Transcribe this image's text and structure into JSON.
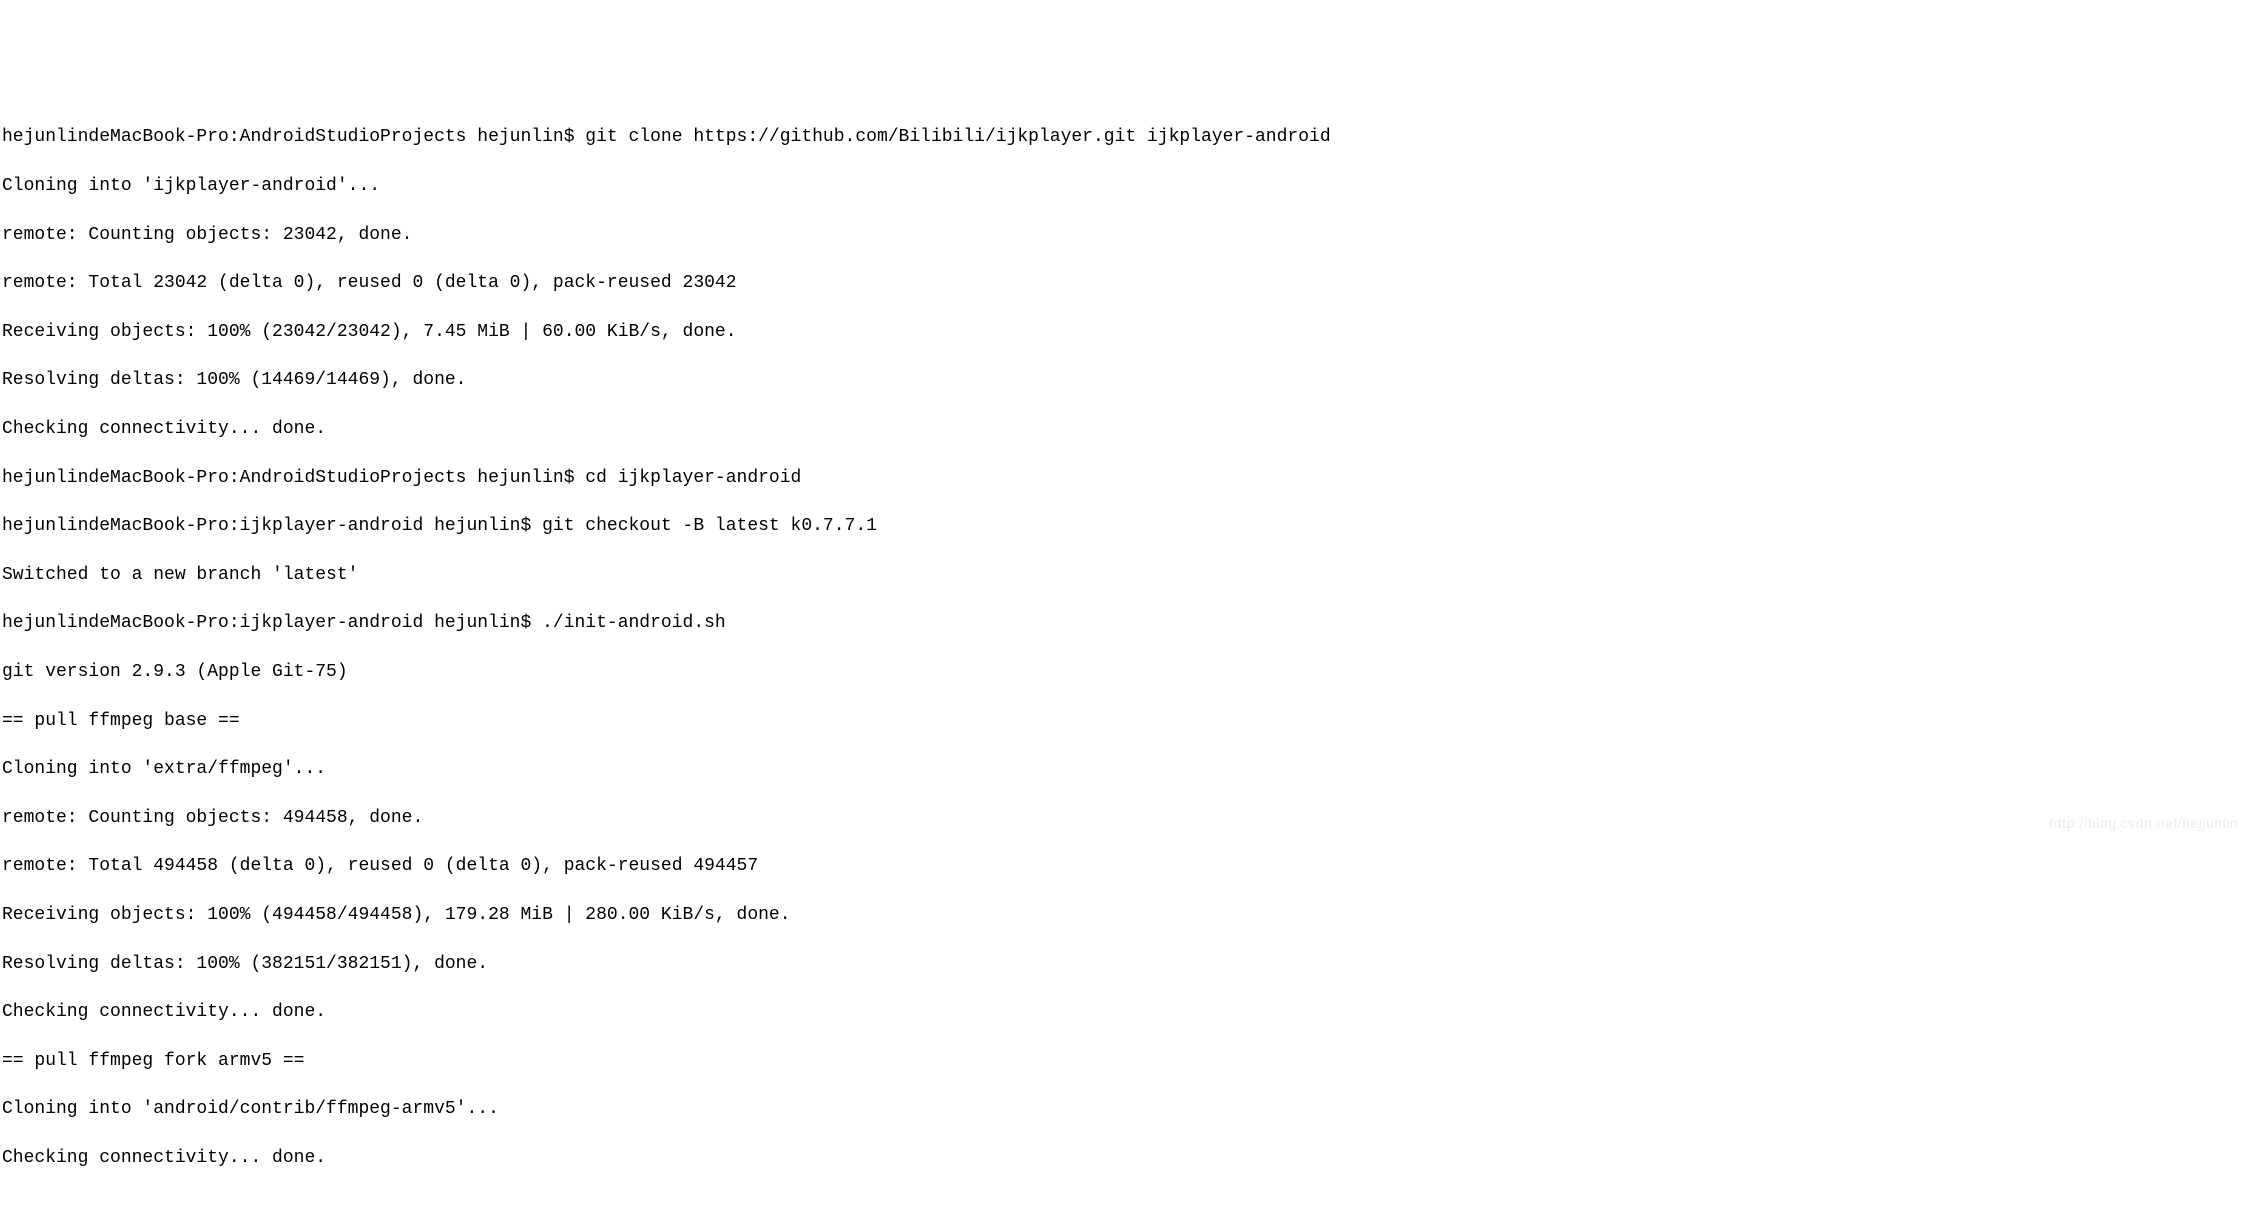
{
  "terminal": {
    "lines": [
      "hejunlindeMacBook-Pro:AndroidStudioProjects hejunlin$ git clone https://github.com/Bilibili/ijkplayer.git ijkplayer-android",
      "Cloning into 'ijkplayer-android'...",
      "remote: Counting objects: 23042, done.",
      "remote: Total 23042 (delta 0), reused 0 (delta 0), pack-reused 23042",
      "Receiving objects: 100% (23042/23042), 7.45 MiB | 60.00 KiB/s, done.",
      "Resolving deltas: 100% (14469/14469), done.",
      "Checking connectivity... done.",
      "hejunlindeMacBook-Pro:AndroidStudioProjects hejunlin$ cd ijkplayer-android",
      "hejunlindeMacBook-Pro:ijkplayer-android hejunlin$ git checkout -B latest k0.7.7.1",
      "Switched to a new branch 'latest'",
      "hejunlindeMacBook-Pro:ijkplayer-android hejunlin$ ./init-android.sh",
      "git version 2.9.3 (Apple Git-75)",
      "== pull ffmpeg base ==",
      "Cloning into 'extra/ffmpeg'...",
      "remote: Counting objects: 494458, done.",
      "remote: Total 494458 (delta 0), reused 0 (delta 0), pack-reused 494457",
      "Receiving objects: 100% (494458/494458), 179.28 MiB | 280.00 KiB/s, done.",
      "Resolving deltas: 100% (382151/382151), done.",
      "Checking connectivity... done.",
      "== pull ffmpeg fork armv5 ==",
      "Cloning into 'android/contrib/ffmpeg-armv5'...",
      "Checking connectivity... done."
    ]
  },
  "watermark": "http://blog.csdn.net/hejjunlin"
}
